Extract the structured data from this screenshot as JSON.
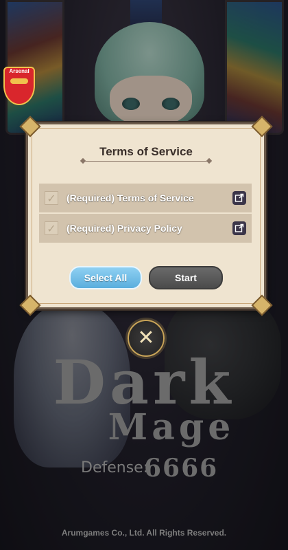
{
  "badge": {
    "label": "Arsenal"
  },
  "dialog": {
    "title": "Terms of Service",
    "terms": [
      {
        "label": "(Required) Terms of Service",
        "checked": true
      },
      {
        "label": "(Required) Privacy Policy",
        "checked": true
      }
    ],
    "select_all_label": "Select All",
    "start_label": "Start"
  },
  "logo": {
    "line1": "Dark",
    "line2": "Mage",
    "defense": "Defense:",
    "number": "6666"
  },
  "footer": {
    "copyright": "Arumgames Co., Ltd. All Rights Reserved."
  },
  "colors": {
    "select_all_button": "#6bbbe6",
    "start_button": "#565656",
    "dialog_bg": "#efe4d0"
  },
  "icons": {
    "check": "checkmark-icon",
    "external": "external-link-icon",
    "close": "close-icon"
  }
}
